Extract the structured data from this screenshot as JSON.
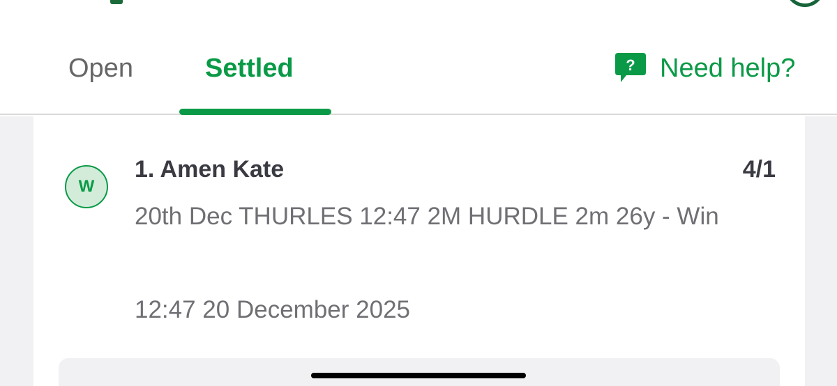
{
  "tabs": {
    "open_label": "Open",
    "settled_label": "Settled",
    "active": "Settled"
  },
  "help": {
    "label": "Need help?",
    "icon": "help-chat-icon",
    "icon_glyph": "?"
  },
  "bet": {
    "result_badge": "W",
    "selection": "1. Amen Kate",
    "odds": "4/1",
    "market": "20th Dec THURLES 12:47 2M HURDLE 2m 26y - Win",
    "placed_at": "12:47 20 December 2025"
  },
  "colors": {
    "accent_green": "#0a9a47",
    "badge_bg": "#d3ecd9",
    "text_dark": "#3a3a42",
    "text_muted": "#6f6f74"
  }
}
